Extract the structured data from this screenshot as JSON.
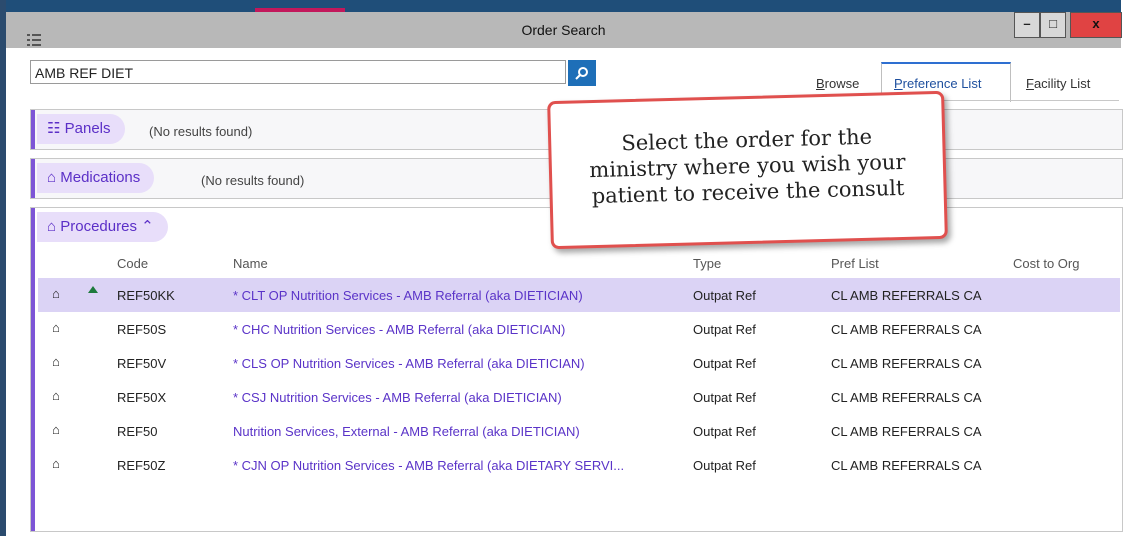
{
  "window": {
    "title": "Order Search",
    "controls": {
      "minimize": "–",
      "maximize": "□",
      "close": "x"
    }
  },
  "search": {
    "value": "AMB REF DIET",
    "button_icon": "search-icon"
  },
  "tabs": [
    {
      "label": "Browse",
      "mnemonic": "B",
      "rest": "rowse"
    },
    {
      "label": "Preference List",
      "mnemonic": "P",
      "rest": "reference List",
      "active": true
    },
    {
      "label": "Facility List",
      "mnemonic": "F",
      "rest": "acility List"
    }
  ],
  "sections": {
    "panels": {
      "label": "Panels",
      "status": "(No results found)",
      "icon": "panels-icon"
    },
    "medications": {
      "label": "Medications",
      "status": "(No results found)",
      "icon": "home-icon"
    },
    "procedures": {
      "label": "Procedures",
      "icon": "home-icon",
      "collapse_icon": "double-chevron-up-icon"
    }
  },
  "table": {
    "columns": [
      "Code",
      "Name",
      "Type",
      "Pref List",
      "Cost to Org"
    ],
    "rows": [
      {
        "code": "REF50KK",
        "name": "* CLT OP Nutrition Services - AMB Referral (aka DIETICIAN)",
        "type": "Outpat Ref",
        "pref_list": "CL AMB REFERRALS CA",
        "cost": "",
        "selected": true
      },
      {
        "code": "REF50S",
        "name": "* CHC Nutrition Services - AMB Referral (aka DIETICIAN)",
        "type": "Outpat Ref",
        "pref_list": "CL AMB REFERRALS CA",
        "cost": ""
      },
      {
        "code": "REF50V",
        "name": "* CLS OP Nutrition Services - AMB Referral (aka DIETICIAN)",
        "type": "Outpat Ref",
        "pref_list": "CL AMB REFERRALS CA",
        "cost": ""
      },
      {
        "code": "REF50X",
        "name": "* CSJ Nutrition Services - AMB Referral (aka DIETICIAN)",
        "type": "Outpat Ref",
        "pref_list": "CL AMB REFERRALS CA",
        "cost": ""
      },
      {
        "code": "REF50",
        "name": "Nutrition Services, External - AMB Referral (aka DIETICIAN)",
        "type": "Outpat Ref",
        "pref_list": "CL AMB REFERRALS CA",
        "cost": ""
      },
      {
        "code": "REF50Z",
        "name": "* CJN OP Nutrition Services - AMB Referral (aka DIETARY SERVI...",
        "type": "Outpat Ref",
        "pref_list": "CL AMB REFERRALS CA",
        "cost": ""
      }
    ]
  },
  "callout": {
    "lines": [
      "Select the order for the",
      "ministry where you wish your",
      "patient to receive the consult"
    ]
  },
  "colors": {
    "accent": "#7d55d6",
    "selected_row": "#dbd3f5",
    "search_button": "#1e6fb8",
    "callout_border": "#e0504e"
  }
}
